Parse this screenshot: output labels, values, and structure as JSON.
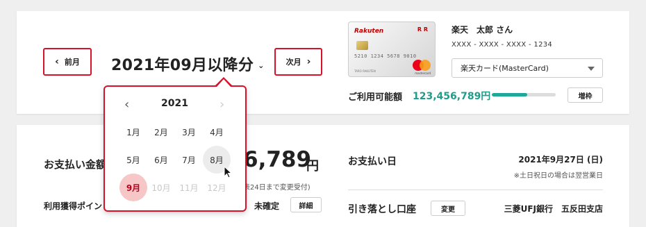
{
  "nav": {
    "prev_label": "前月",
    "next_label": "次月",
    "period_label": "2021年09月以降分"
  },
  "card": {
    "brand": "Rakuten",
    "image_number": "5210 1234 5678 9010",
    "image_holder": "TARO RAKUTEN",
    "holder_name": "楽天　太郎 さん",
    "masked_number": "XXXX - XXXX - XXXX - 1234",
    "selected_card": "楽天カード(MasterCard)"
  },
  "available": {
    "label": "ご利用可能額",
    "value": "123,456,789円",
    "fill_fraction": 0.55,
    "increase_label": "増枠",
    "bar_color": "#1fa898"
  },
  "payment": {
    "amount_label": "お支払い金額",
    "amount": "6,789",
    "currency": "円",
    "amount_note": "表24日まで変更受付)",
    "points_label": "利用獲得ポイン",
    "status": "未確定",
    "detail_label": "詳細",
    "date_label": "お支払い日",
    "date": "2021年9月27日 (日)",
    "date_note": "※土日祝日の場合は翌営業日",
    "account_label": "引き落とし口座",
    "change_label": "変更",
    "bank": "三菱UFJ銀行　五反田支店"
  },
  "picker": {
    "year": "2021",
    "months": [
      {
        "label": "1月",
        "state": "normal"
      },
      {
        "label": "2月",
        "state": "normal"
      },
      {
        "label": "3月",
        "state": "normal"
      },
      {
        "label": "4月",
        "state": "normal"
      },
      {
        "label": "5月",
        "state": "normal"
      },
      {
        "label": "6月",
        "state": "normal"
      },
      {
        "label": "7月",
        "state": "normal"
      },
      {
        "label": "8月",
        "state": "hover"
      },
      {
        "label": "9月",
        "state": "selected"
      },
      {
        "label": "10月",
        "state": "disabled"
      },
      {
        "label": "11月",
        "state": "disabled"
      },
      {
        "label": "12月",
        "state": "disabled"
      }
    ]
  },
  "colors": {
    "accent": "#d8112a",
    "teal": "#1f9c8a",
    "selected_bg": "#f7c7c7"
  }
}
